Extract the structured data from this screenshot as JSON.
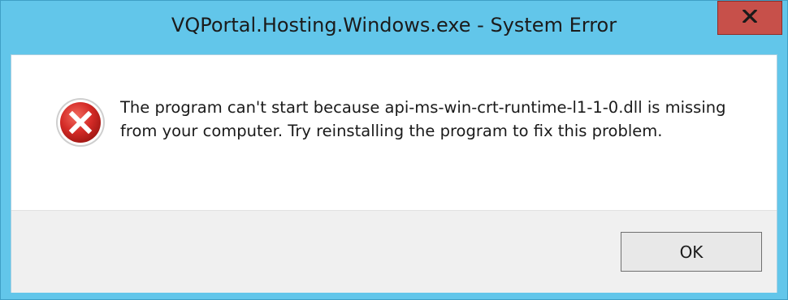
{
  "window": {
    "title": "VQPortal.Hosting.Windows.exe - System Error",
    "close_icon": "close-icon"
  },
  "dialog": {
    "icon": "error-icon",
    "message": "The program can't start because api-ms-win-crt-runtime-l1-1-0.dll is missing from your computer. Try reinstalling the program to fix this problem.",
    "ok_label": "OK"
  },
  "colors": {
    "frame": "#62c6ea",
    "close_button": "#c7504a",
    "error_red": "#d42b27",
    "button_area": "#f0f0f0"
  }
}
